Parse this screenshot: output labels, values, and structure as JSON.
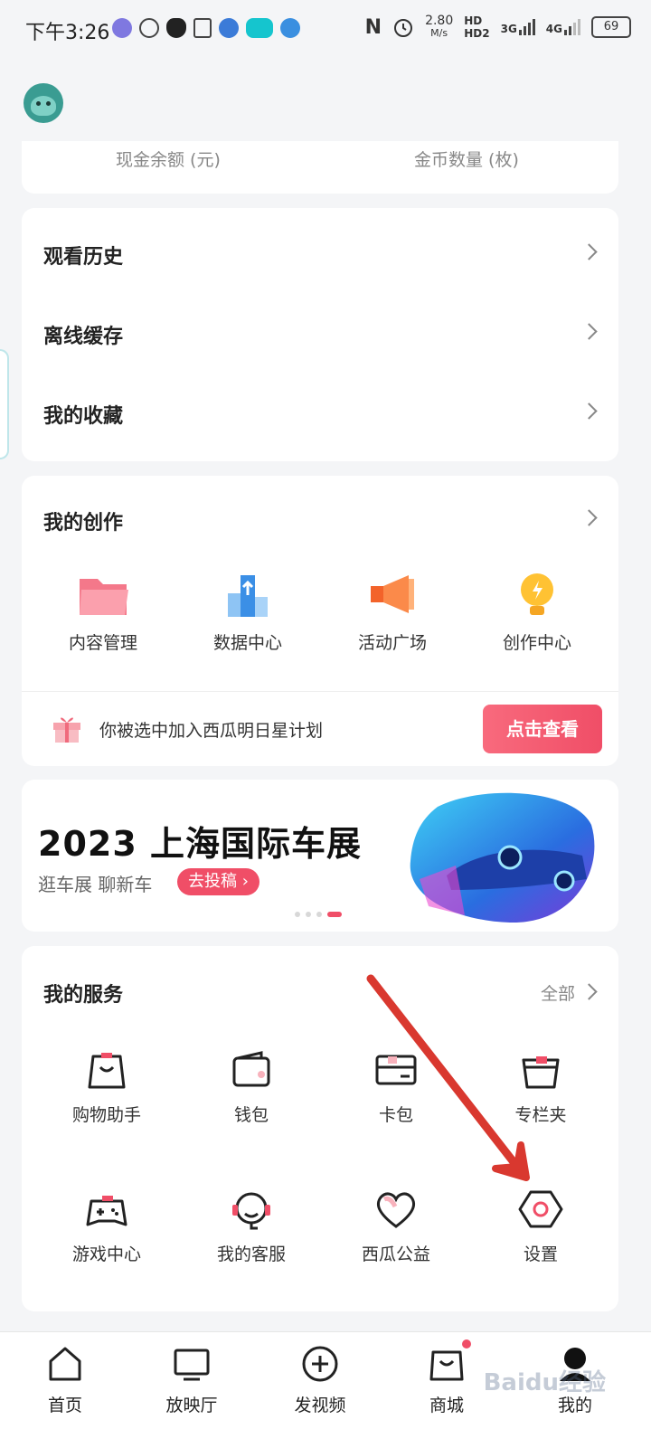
{
  "status_bar": {
    "time": "下午3:26",
    "speed_value": "2.80",
    "speed_unit": "M/s",
    "hd_label_1": "HD",
    "hd_label_2": "HD2",
    "network_3g": "3G",
    "network_4g": "4G",
    "battery": "69"
  },
  "account": {
    "cash_label": "现金余额 (元)",
    "coin_label": "金币数量 (枚)"
  },
  "menu": [
    {
      "label": "观看历史"
    },
    {
      "label": "离线缓存"
    },
    {
      "label": "我的收藏"
    }
  ],
  "creation": {
    "title": "我的创作",
    "items": [
      {
        "label": "内容管理",
        "icon": "folder-icon"
      },
      {
        "label": "数据中心",
        "icon": "bar-chart-icon"
      },
      {
        "label": "活动广场",
        "icon": "megaphone-icon"
      },
      {
        "label": "创作中心",
        "icon": "lightbulb-icon"
      }
    ],
    "notice_text": "你被选中加入西瓜明日星计划",
    "notice_button": "点击查看"
  },
  "banner": {
    "title": "2023 上海国际车展",
    "subtitle": "逛车展 聊新车",
    "tag": "去投稿 ›"
  },
  "services": {
    "title": "我的服务",
    "all_label": "全部",
    "items": [
      {
        "label": "购物助手",
        "icon": "shopping-bag-icon"
      },
      {
        "label": "钱包",
        "icon": "wallet-icon"
      },
      {
        "label": "卡包",
        "icon": "card-icon"
      },
      {
        "label": "专栏夹",
        "icon": "basket-icon"
      },
      {
        "label": "游戏中心",
        "icon": "gamepad-icon"
      },
      {
        "label": "我的客服",
        "icon": "headset-icon"
      },
      {
        "label": "西瓜公益",
        "icon": "heart-icon"
      },
      {
        "label": "设置",
        "icon": "settings-icon"
      }
    ]
  },
  "tabbar": [
    {
      "label": "首页",
      "icon": "home-icon"
    },
    {
      "label": "放映厅",
      "icon": "tv-icon"
    },
    {
      "label": "发视频",
      "icon": "plus-circle-icon"
    },
    {
      "label": "商城",
      "icon": "bag-icon"
    },
    {
      "label": "我的",
      "icon": "profile-icon"
    }
  ],
  "watermark": "Baidu经验",
  "colors": {
    "accent": "#f04e67",
    "background": "#f4f5f7"
  }
}
